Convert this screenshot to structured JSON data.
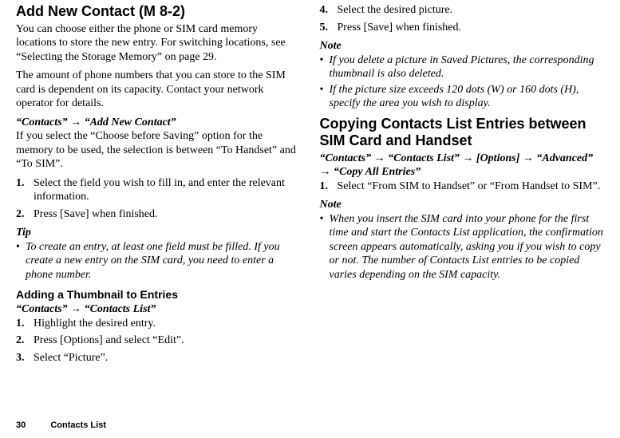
{
  "left": {
    "h_add_new_contact": "Add New Contact",
    "mcode": "(M 8-2)",
    "intro1": "You can choose either the phone or SIM card memory locations to store the new entry. For switching locations, see “Selecting the Storage Memory” on page 29.",
    "intro2": "The amount of phone numbers that you can store to the SIM card is dependent on its capacity. Contact your network operator for details.",
    "nav_add": "“Contacts” → “Add New Contact”",
    "choose_before": "If you select the “Choose before Saving” option for the memory to be used, the selection is between “To Handset” and “To SIM”.",
    "steps_add": [
      "Select the field you wish to fill in, and enter the relevant information.",
      "Press [Save] when finished."
    ],
    "tip_label": "Tip",
    "tip_text": "To create an entry, at least one field must be filled. If you create a new entry on the SIM card, you need to enter a phone number.",
    "h_thumb": "Adding a Thumbnail to Entries",
    "nav_thumb": "“Contacts” → “Contacts List”",
    "steps_thumb": [
      "Highlight the desired entry.",
      "Press [Options] and select “Edit”.",
      "Select “Picture”."
    ]
  },
  "right": {
    "steps_thumb_cont": [
      {
        "n": "4.",
        "t": "Select the desired picture."
      },
      {
        "n": "5.",
        "t": "Press [Save] when finished."
      }
    ],
    "note_label": "Note",
    "notes_thumb": [
      "If you delete a picture in Saved Pictures, the corresponding thumbnail is also deleted.",
      "If the picture size exceeds 120 dots (W) or 160 dots (H), specify the area you wish to display."
    ],
    "h_copy": "Copying Contacts List Entries between SIM Card and Handset",
    "nav_copy": "“Contacts” → “Contacts List” → [Options] → “Advanced” → “Copy All Entries”",
    "steps_copy": [
      "Select “From SIM to Handset” or “From Handset to SIM”."
    ],
    "note2_label": "Note",
    "notes_copy": [
      "When you insert the SIM card into your phone for the first time and start the Contacts List application, the confirmation screen appears automatically, asking you if you wish to copy or not. The number of Contacts List entries to be copied varies depending on the SIM capacity."
    ]
  },
  "footer": {
    "page_num": "30",
    "section": "Contacts List"
  }
}
